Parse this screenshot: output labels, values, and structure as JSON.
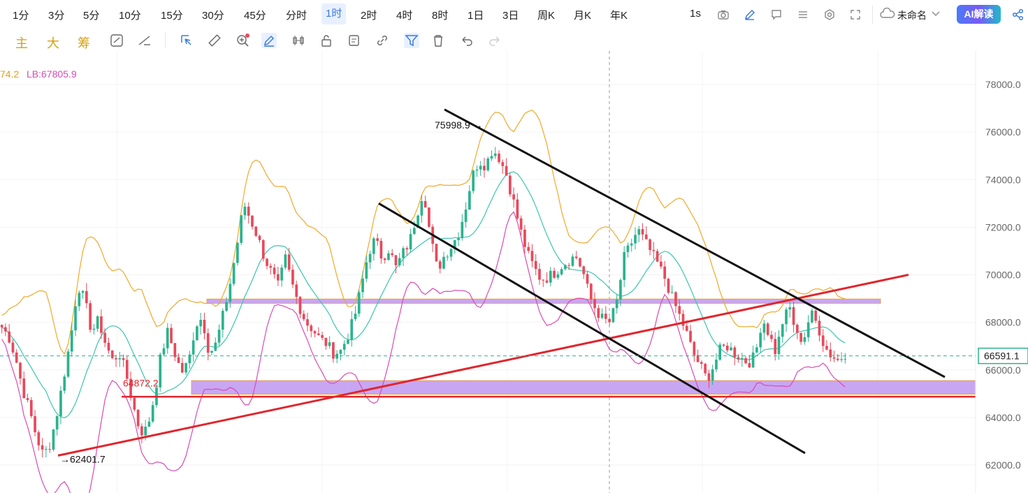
{
  "timeframes": [
    "1分",
    "3分",
    "5分",
    "10分",
    "15分",
    "30分",
    "45分",
    "分时",
    "1时",
    "2时",
    "4时",
    "8时",
    "1日",
    "3日",
    "周K",
    "月K",
    "年K"
  ],
  "active_timeframe": "1时",
  "right_toolbar": {
    "refresh_label": "1s",
    "layout_name": "未命名",
    "ai_button": "AI解读"
  },
  "indicator_buttons": [
    "主",
    "大",
    "筹"
  ],
  "legend": {
    "partial_value": "74.2",
    "lb": "LB:67805.9"
  },
  "colors": {
    "up": "#2bb38d",
    "down": "#e8495b",
    "upper_band": "#f0a92b",
    "mid_band": "#3cc4b0",
    "lower_band": "#d84bb4",
    "zone": "#c9a6f2",
    "trend_red": "#e0262e",
    "channel": "#111111",
    "price_line": "#2bb38d",
    "accent": "#3b7bd9"
  },
  "chart_data": {
    "type": "candlestick",
    "y_ticks": [
      "78000.0",
      "76000.0",
      "74000.0",
      "72000.0",
      "70000.0",
      "68000.0",
      "66000.0",
      "64000.0",
      "62000.0"
    ],
    "ylim": [
      61500,
      79500
    ],
    "current_price": "66591.1",
    "annotations": {
      "high": "75998.9",
      "low": "62401.7",
      "level": "64872.2"
    },
    "close_path": [
      67800,
      67400,
      66500,
      65200,
      64300,
      63200,
      62400,
      62900,
      64200,
      65800,
      67400,
      69600,
      68900,
      67600,
      68100,
      67100,
      66400,
      66700,
      65800,
      64500,
      63400,
      63500,
      64800,
      66600,
      67600,
      66700,
      65900,
      66300,
      67900,
      68200,
      66700,
      67100,
      68300,
      69600,
      71200,
      73000,
      72300,
      71600,
      70700,
      70100,
      69500,
      70700,
      69600,
      68700,
      68000,
      67700,
      67300,
      67100,
      66700,
      66800,
      67400,
      68200,
      69500,
      70900,
      71500,
      70700,
      71100,
      70300,
      70900,
      71400,
      72500,
      73600,
      71600,
      70200,
      70800,
      71200,
      71700,
      72700,
      74100,
      74800,
      74600,
      75300,
      74900,
      74200,
      73100,
      71900,
      70900,
      70300,
      69800,
      69900,
      70100,
      70400,
      70600,
      70800,
      70200,
      69100,
      68500,
      68100,
      68000,
      68900,
      70700,
      71300,
      71900,
      71400,
      70900,
      70400,
      69800,
      69000,
      68300,
      67600,
      66700,
      66200,
      65600,
      66200,
      66900,
      67000,
      66700,
      66500,
      66300,
      66600,
      68200,
      67500,
      66700,
      68100,
      68600,
      67400,
      67300,
      68400,
      67900,
      67000,
      66600,
      66400,
      66700
    ]
  }
}
